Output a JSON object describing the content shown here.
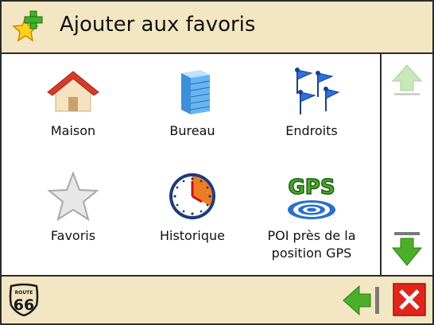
{
  "header": {
    "title": "Ajouter aux favoris",
    "icon": "star-plus-icon"
  },
  "items": [
    {
      "label": "Maison",
      "icon": "house-icon"
    },
    {
      "label": "Bureau",
      "icon": "office-building-icon"
    },
    {
      "label": "Endroits",
      "icon": "flags-icon"
    },
    {
      "label": "Favoris",
      "icon": "star-icon"
    },
    {
      "label": "Historique",
      "icon": "clock-icon"
    },
    {
      "label": "POI près de la position GPS",
      "icon": "gps-icon"
    }
  ],
  "scroll": {
    "up_icon": "arrow-up-icon",
    "down_icon": "arrow-down-icon"
  },
  "footer": {
    "logo_top": "ROUTE",
    "logo_number": "66",
    "back_icon": "back-arrow-icon",
    "close_icon": "close-icon"
  },
  "colors": {
    "background": "#f3e6c2",
    "border": "#2b2b2b",
    "green": "#4caf2a",
    "red": "#e0261b"
  }
}
